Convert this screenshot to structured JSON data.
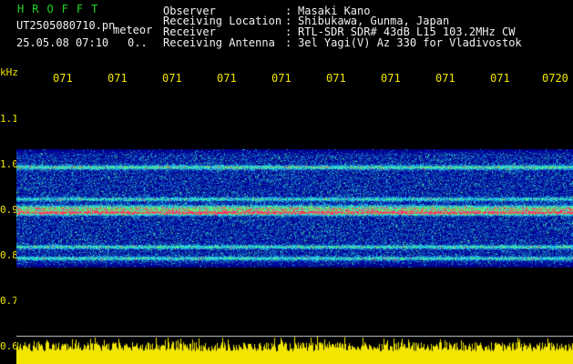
{
  "header": {
    "brand": "HROFFT",
    "filename": "UT2505080710.pn",
    "datetime": "25.05.08 07:10",
    "counter": "0..",
    "mode": "meteor",
    "fields": [
      {
        "label": "Observer",
        "sep": ":",
        "value": "Masaki Kano"
      },
      {
        "label": "Receiving Location",
        "sep": ":",
        "value": "Shibukawa, Gunma, Japan"
      },
      {
        "label": "Receiver",
        "sep": ":",
        "value": "RTL-SDR SDR# 43dB L15 103.2MHz CW"
      },
      {
        "label": "Receiving Antenna",
        "sep": ":",
        "value": "3el Yagi(V) Az 330 for Vladivostok"
      }
    ]
  },
  "axis": {
    "y_unit": "kHz",
    "y_ticks": [
      {
        "label": "1.1",
        "value": 1.1
      },
      {
        "label": "1.0",
        "value": 1.0
      },
      {
        "label": "0.9",
        "value": 0.9
      },
      {
        "label": "0.8",
        "value": 0.8
      },
      {
        "label": "0.7",
        "value": 0.7
      },
      {
        "label": "0.6",
        "value": 0.6
      }
    ],
    "x_ticks": [
      "071",
      "071",
      "071",
      "071",
      "071",
      "071",
      "071",
      "071",
      "071",
      "0720"
    ]
  },
  "colors": {
    "background": "#000000",
    "text": "#f2f2f2",
    "brand": "#1fd51f",
    "axis": "#f2e600",
    "band_strong": "#ff2a6e",
    "noise_low": "#0a1a8c",
    "noise_mid": "#1ecaff",
    "noise_high": "#5bff60",
    "level": "#f2e600"
  }
}
